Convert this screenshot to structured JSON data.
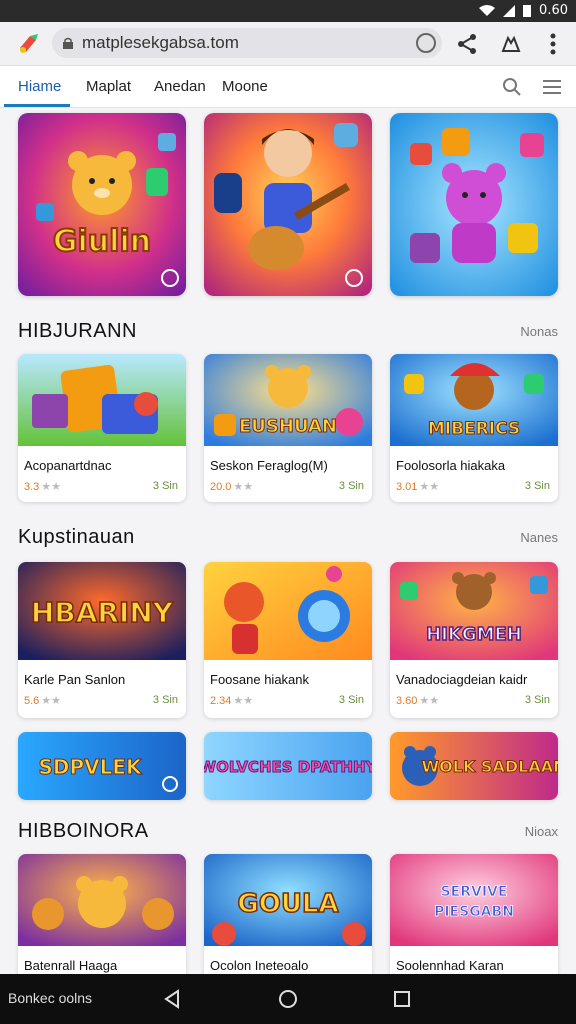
{
  "status": {
    "time": "0.60"
  },
  "browser": {
    "url": "matplesekgabsa.tom"
  },
  "tabs": [
    {
      "label": "Hiame",
      "active": true
    },
    {
      "label": "Maplat",
      "active": false
    },
    {
      "label": "Anedan",
      "active": false
    },
    {
      "label": "Moone",
      "active": false
    }
  ],
  "hero": [
    {
      "text": "Giulin"
    },
    {
      "text": ""
    },
    {
      "text": ""
    }
  ],
  "sections": [
    {
      "title": "HIBJURANN",
      "more": "Nonas",
      "cards": [
        {
          "title": "Acopanartdnac",
          "rating": "3.3",
          "size": "3 Sin",
          "thumb_text": ""
        },
        {
          "title": "Seskon Feraglog(M)",
          "rating": "20.0",
          "size": "3 Sin",
          "thumb_text": "EUSHUAN"
        },
        {
          "title": "Foolosorla hiakaka",
          "rating": "3.01",
          "size": "3 Sin",
          "thumb_text": "MIBERICS"
        }
      ]
    },
    {
      "title": "Kupstinauan",
      "more": "Nanes",
      "cards": [
        {
          "title": "Karle Pan Sanlon",
          "rating": "5.6",
          "size": "3 Sin",
          "thumb_text": "HBARINY"
        },
        {
          "title": "Foosane hiakank",
          "rating": "2.34",
          "size": "3 Sin",
          "thumb_text": ""
        },
        {
          "title": "Vanadociagdeian kaidr",
          "rating": "3.60",
          "size": "3 Sin",
          "thumb_text": "HIKGMEH"
        }
      ]
    },
    {
      "title": "HIBBOINORA",
      "more": "Nioax",
      "cards": [
        {
          "title": "Batenrall Haaga",
          "rating": "",
          "size": "",
          "thumb_text": ""
        },
        {
          "title": "Ocolon Ineteoalo",
          "rating": "",
          "size": "",
          "thumb_text": "GOULA"
        },
        {
          "title": "Soolennhad Karan",
          "rating": "",
          "size": "",
          "thumb_text": "SERVIVE PIESGABN"
        }
      ]
    }
  ],
  "banners": [
    {
      "text": "SDPVLEK"
    },
    {
      "text": "WOLVCHES DPATHHY"
    },
    {
      "text": "WOLK SADLAAN"
    }
  ],
  "navbar": {
    "label": "Bonkec oolns"
  },
  "colors": {
    "accent": "#1a7bbd",
    "rating": "#e07a2a",
    "size": "#6b8e3a"
  }
}
